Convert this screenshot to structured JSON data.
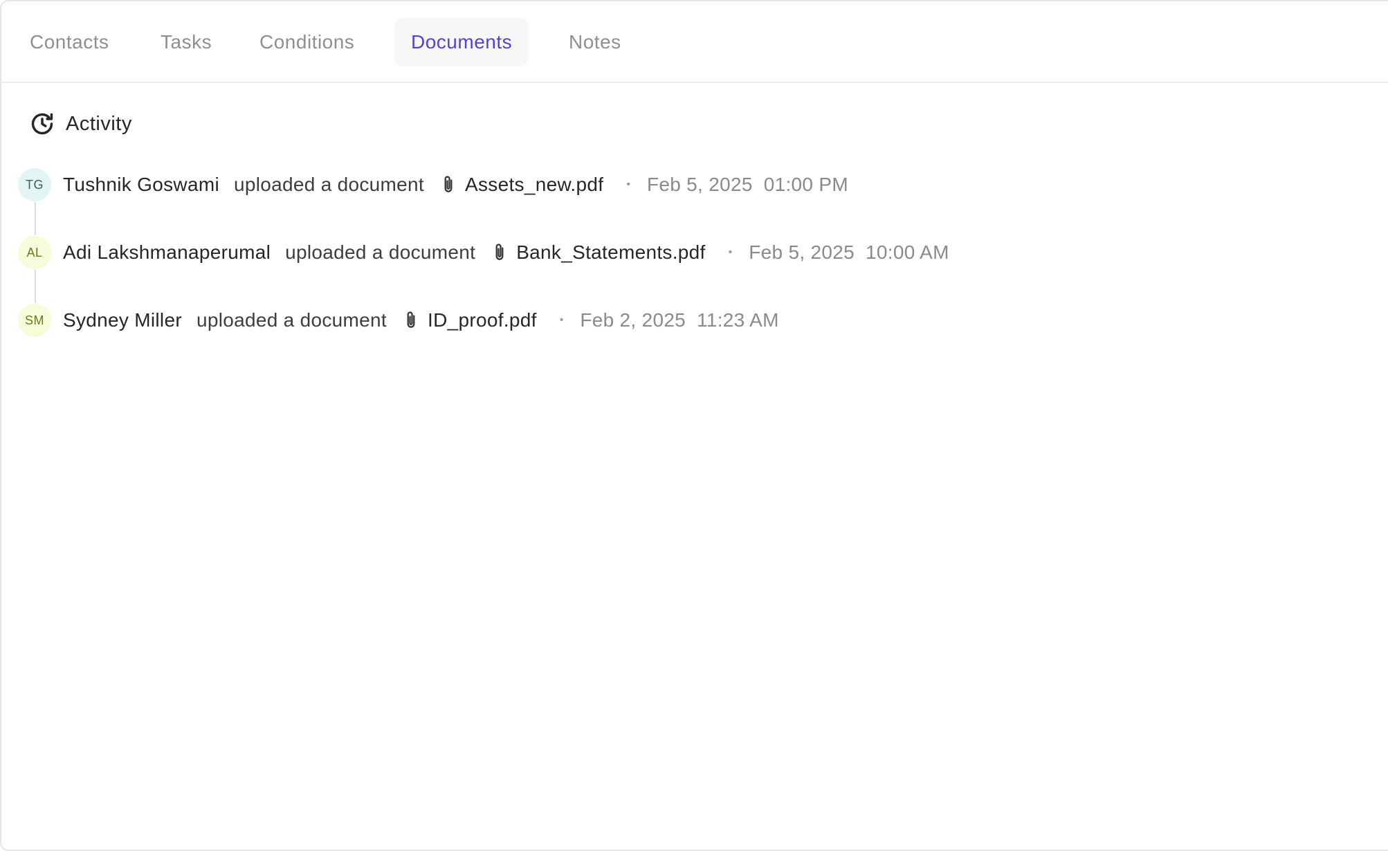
{
  "tabs": [
    {
      "label": "Contacts",
      "active": false
    },
    {
      "label": "Tasks",
      "active": false
    },
    {
      "label": "Conditions",
      "active": false
    },
    {
      "label": "Documents",
      "active": true
    },
    {
      "label": "Notes",
      "active": false
    }
  ],
  "activity": {
    "title": "Activity",
    "icon": "history-icon",
    "entries": [
      {
        "initials": "TG",
        "avatar_bg": "#e3f4f4",
        "avatar_fg": "#4a5a5a",
        "name": "Tushnik Goswami",
        "action": "uploaded a document",
        "file_icon": "paperclip-icon",
        "file": "Assets_new.pdf",
        "separator": "•",
        "date": "Feb 5, 2025",
        "time": "01:00 PM"
      },
      {
        "initials": "AL",
        "avatar_bg": "#f6fbd9",
        "avatar_fg": "#6b7a1f",
        "name": "Adi Lakshmanaperumal",
        "action": "uploaded a document",
        "file_icon": "paperclip-icon",
        "file": "Bank_Statements.pdf",
        "separator": "•",
        "date": "Feb 5, 2025",
        "time": "10:00 AM"
      },
      {
        "initials": "SM",
        "avatar_bg": "#f6fbd9",
        "avatar_fg": "#6b7a1f",
        "name": "Sydney Miller",
        "action": "uploaded a document",
        "file_icon": "paperclip-icon",
        "file": "ID_proof.pdf",
        "separator": "•",
        "date": "Feb 2, 2025",
        "time": "11:23 AM"
      }
    ]
  },
  "colors": {
    "accent": "#5b3fd3",
    "text": "#262626",
    "muted": "#8a8a8a"
  }
}
